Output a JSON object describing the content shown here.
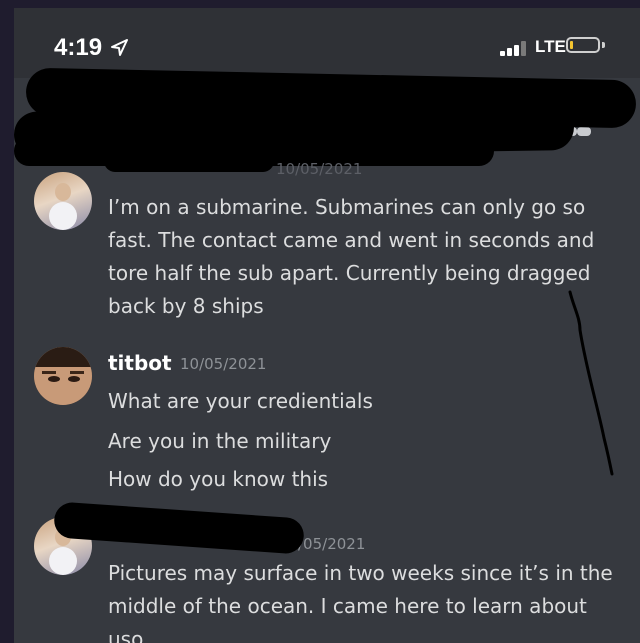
{
  "status_bar": {
    "time": "4:19",
    "network": "LTE",
    "signal_bars_active": 3,
    "battery_level": 0.1,
    "location_icon": "location-arrow-icon"
  },
  "messages": [
    {
      "author": "",
      "timestamp": "10/05/2021",
      "text": "I’m on a submarine. Submarines can only go so fast. The contact came and went in seconds and tore half the sub apart. Currently being dragged back by 8 ships"
    },
    {
      "author": "titbot",
      "timestamp": "10/05/2021",
      "lines": [
        "What are your credientials",
        "Are you in the military",
        "How do you know this"
      ]
    },
    {
      "author": "",
      "timestamp": "/05/2021",
      "text": "Pictures may surface in two weeks since it’s in the middle of the ocean. I came here to learn about uso"
    }
  ],
  "colors": {
    "background": "#36393f",
    "status_bar": "#2f3136",
    "text": "#dcddde",
    "timestamp": "#8e9297",
    "author": "#ffffff"
  }
}
